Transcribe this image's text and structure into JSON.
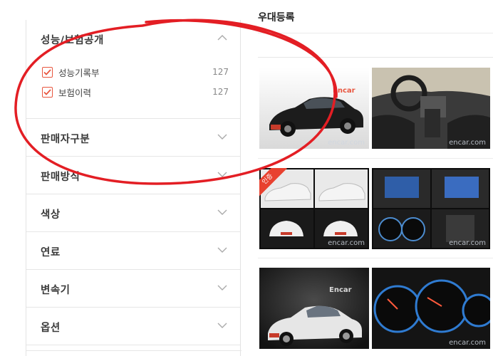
{
  "filters": {
    "sections": [
      {
        "title": "성능/보험공개",
        "expanded": true,
        "options": [
          {
            "label": "성능기록부",
            "count": "127",
            "checked": true
          },
          {
            "label": "보험이력",
            "count": "127",
            "checked": true
          }
        ]
      },
      {
        "title": "판매자구분",
        "expanded": false
      },
      {
        "title": "판매방식",
        "expanded": false
      },
      {
        "title": "색상",
        "expanded": false
      },
      {
        "title": "연료",
        "expanded": false
      },
      {
        "title": "변속기",
        "expanded": false
      },
      {
        "title": "옵션",
        "expanded": false
      }
    ]
  },
  "content": {
    "title": "우대등록",
    "watermark": "encar.com",
    "photo_brand": "Encar",
    "badge": "인증"
  },
  "colors": {
    "accent": "#e8563f",
    "annotation": "#e31e24"
  }
}
